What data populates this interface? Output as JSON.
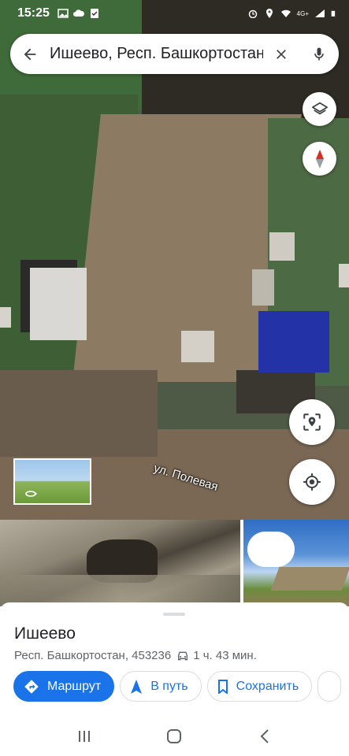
{
  "status_bar": {
    "time": "15:25",
    "network": "4G+"
  },
  "search": {
    "query": "Ишеево, Респ. Башкортостан",
    "back_icon": "arrow-back-icon",
    "clear_icon": "close-icon",
    "mic_icon": "mic-icon"
  },
  "map": {
    "street_label": "ул. Полевая",
    "layers_icon": "layers-icon",
    "compass_icon": "compass-icon",
    "nearby_icon": "location-scan-icon",
    "my_location_icon": "my-location-icon"
  },
  "place": {
    "name": "Ишеево",
    "address": "Респ. Башкортостан, 453236",
    "drive_time": "1 ч. 43 мин."
  },
  "actions": {
    "route_label": "Маршрут",
    "start_label": "В путь",
    "save_label": "Сохранить"
  },
  "colors": {
    "accent": "#1a73e8",
    "text": "#202124",
    "secondary_text": "#5f6368"
  }
}
